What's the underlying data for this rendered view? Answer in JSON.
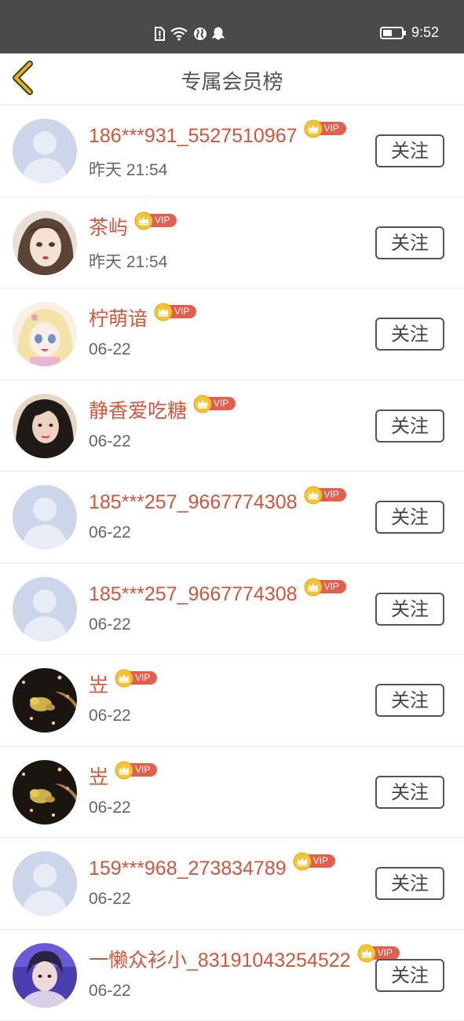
{
  "status_bar": {
    "time": "9:52",
    "icons": [
      "sim-alert-icon",
      "wifi-icon",
      "globe-icon",
      "qq-icon",
      "battery-icon"
    ]
  },
  "nav": {
    "back_icon": "chevron-left-icon",
    "title": "专属会员榜"
  },
  "colors": {
    "status_bar_bg": "#4a4a4a",
    "name_color": "#d6553a",
    "vip_badge": "#e35e4c",
    "back_arrow": "#e8b400"
  },
  "vip_label": "VIP",
  "follow_label": "关注",
  "members": [
    {
      "name": "186***931_5527510967",
      "date": "昨天 21:54",
      "avatar": "default"
    },
    {
      "name": "茶屿",
      "date": "昨天 21:54",
      "avatar": "girl-illustration"
    },
    {
      "name": "柠萌谙",
      "date": "06-22",
      "avatar": "anime-girl"
    },
    {
      "name": "静香爱吃糖",
      "date": "06-22",
      "avatar": "photo-girl"
    },
    {
      "name": "185***257_9667774308",
      "date": "06-22",
      "avatar": "default"
    },
    {
      "name": "185***257_9667774308",
      "date": "06-22",
      "avatar": "default"
    },
    {
      "name": "岦",
      "date": "06-22",
      "avatar": "night-lights"
    },
    {
      "name": "岦",
      "date": "06-22",
      "avatar": "night-lights"
    },
    {
      "name": "159***968_273834789",
      "date": "06-22",
      "avatar": "default"
    },
    {
      "name": "一懒众衫小_83191043254522",
      "date": "06-22",
      "avatar": "purple-boy"
    }
  ]
}
